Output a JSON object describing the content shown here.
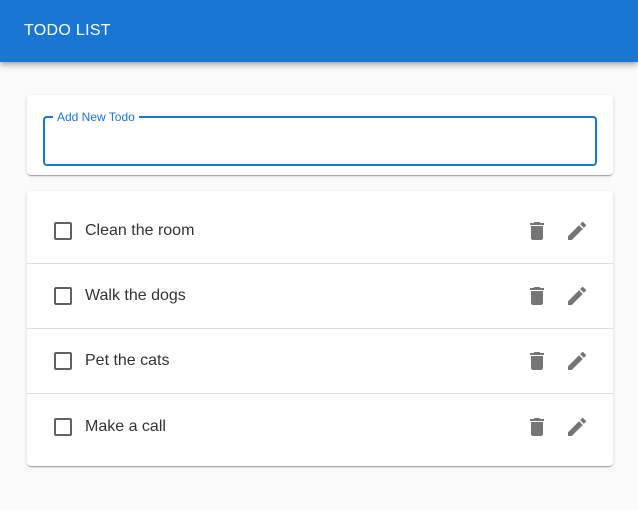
{
  "appbar": {
    "title": "TODO LIST"
  },
  "new_todo": {
    "label": "Add New Todo",
    "value": ""
  },
  "todos": [
    {
      "text": "Clean the room",
      "completed": false
    },
    {
      "text": "Walk the dogs",
      "completed": false
    },
    {
      "text": "Pet the cats",
      "completed": false
    },
    {
      "text": "Make a call",
      "completed": false
    }
  ],
  "icons": {
    "delete": "trash-icon",
    "edit": "pencil-icon"
  },
  "colors": {
    "primary": "#1976d2",
    "icon": "#757575",
    "background": "#fafafa"
  }
}
